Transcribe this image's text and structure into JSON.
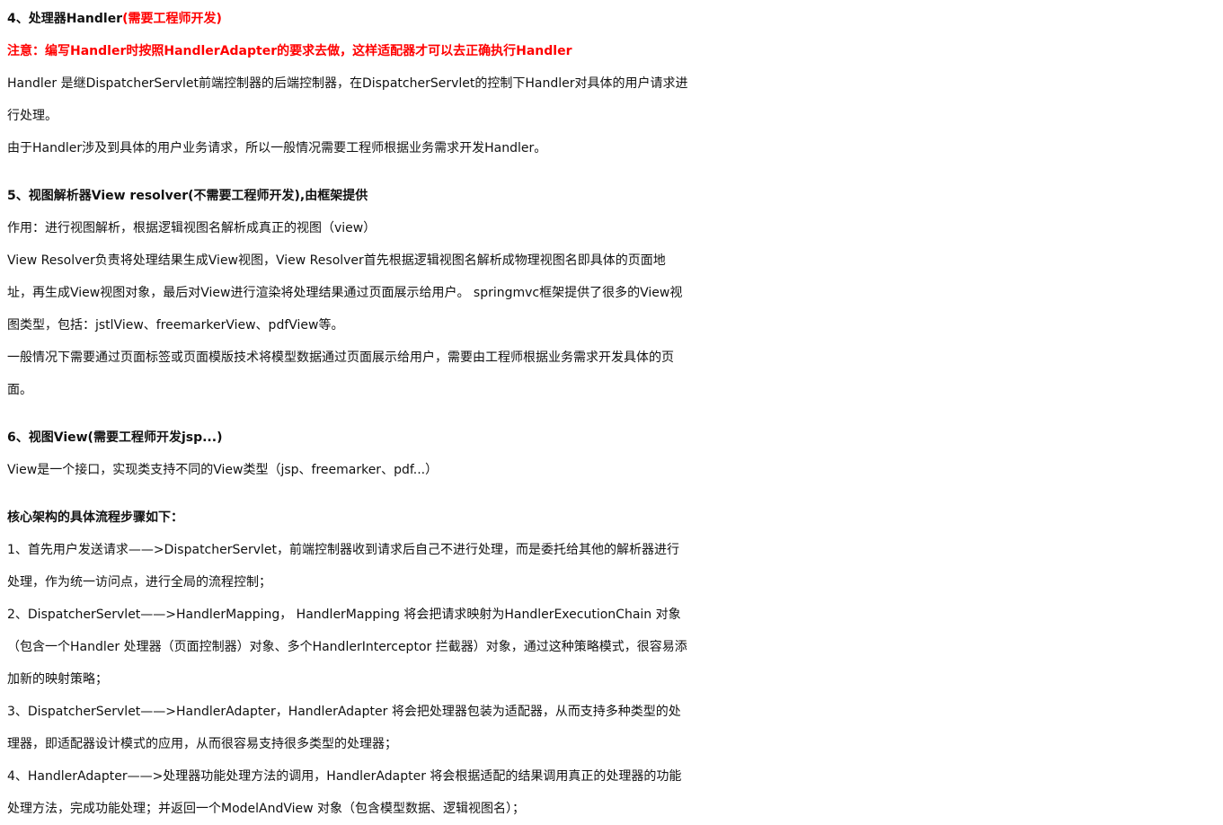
{
  "section4": {
    "heading": "4、处理器Handler",
    "heading_note": "(需要工程师开发)",
    "notice": "注意：编写Handler时按照HandlerAdapter的要求去做，这样适配器才可以去正确执行Handler",
    "para1_line1": "Handler 是继DispatcherServlet前端控制器的后端控制器，在DispatcherServlet的控制下Handler对具体的用户请求进",
    "para1_line2": "行处理。",
    "para2": "由于Handler涉及到具体的用户业务请求，所以一般情况需要工程师根据业务需求开发Handler。"
  },
  "section5": {
    "heading": "5、视图解析器View resolver(不需要工程师开发),由框架提供",
    "para1": "作用：进行视图解析，根据逻辑视图名解析成真正的视图（view）",
    "para2_line1": "View Resolver负责将处理结果生成View视图，View Resolver首先根据逻辑视图名解析成物理视图名即具体的页面地",
    "para2_line2": "址，再生成View视图对象，最后对View进行渲染将处理结果通过页面展示给用户。 springmvc框架提供了很多的View视",
    "para2_line3": "图类型，包括：jstlView、freemarkerView、pdfView等。",
    "para3_line1": "一般情况下需要通过页面标签或页面模版技术将模型数据通过页面展示给用户，需要由工程师根据业务需求开发具体的页",
    "para3_line2": "面。"
  },
  "section6": {
    "heading": "6、视图View(需要工程师开发jsp...)",
    "para1": "View是一个接口，实现类支持不同的View类型（jsp、freemarker、pdf...）"
  },
  "flow": {
    "heading": "核心架构的具体流程步骤如下：",
    "step1_line1": "1、首先用户发送请求——>DispatcherServlet，前端控制器收到请求后自己不进行处理，而是委托给其他的解析器进行",
    "step1_line2": "处理，作为统一访问点，进行全局的流程控制；",
    "step2_line1": "2、DispatcherServlet——>HandlerMapping， HandlerMapping 将会把请求映射为HandlerExecutionChain 对象",
    "step2_line2": "（包含一个Handler 处理器（页面控制器）对象、多个HandlerInterceptor 拦截器）对象，通过这种策略模式，很容易添",
    "step2_line3": "加新的映射策略；",
    "step3_line1": "3、DispatcherServlet——>HandlerAdapter，HandlerAdapter 将会把处理器包装为适配器，从而支持多种类型的处",
    "step3_line2": "理器，即适配器设计模式的应用，从而很容易支持很多类型的处理器；",
    "step4_line1": "4、HandlerAdapter——>处理器功能处理方法的调用，HandlerAdapter 将会根据适配的结果调用真正的处理器的功能",
    "step4_line2": "处理方法，完成功能处理；并返回一个ModelAndView 对象（包含模型数据、逻辑视图名）；"
  },
  "colors": {
    "text": "#111111",
    "accent_red": "#ff0000",
    "background": "#ffffff"
  }
}
